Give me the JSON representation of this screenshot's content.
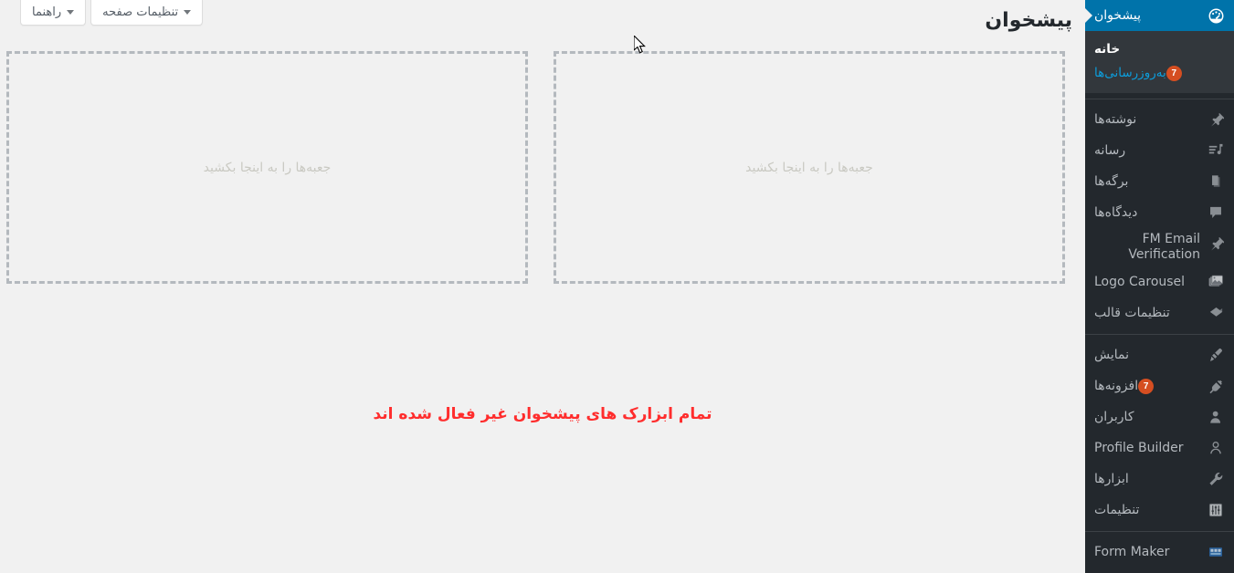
{
  "page": {
    "title": "پیشخوان",
    "widgets_disabled_message": "تمام ابزارک های پیشخوان غیر فعال شده اند"
  },
  "screen_meta": {
    "screen_options_label": "تنظیمات صفحه",
    "help_label": "راهنما"
  },
  "dashboard": {
    "drop_placeholder_right": "جعبه‌ها را به اینجا بکشید",
    "drop_placeholder_left": "جعبه‌ها را به اینجا بکشید"
  },
  "sidebar": {
    "active_item": "پیشخوان",
    "items": [
      {
        "label": "پیشخوان",
        "icon": "dashboard-icon",
        "current": true
      },
      {
        "label": "نوشته‌ها",
        "icon": "pin-icon"
      },
      {
        "label": "رسانه",
        "icon": "media-icon"
      },
      {
        "label": "برگه‌ها",
        "icon": "pages-icon"
      },
      {
        "label": "دیدگاه‌ها",
        "icon": "comments-icon"
      },
      {
        "label": "FM Email Verification",
        "icon": "pin-icon",
        "latin": true
      },
      {
        "label": "Logo Carousel",
        "icon": "gallery-icon",
        "latin": true
      },
      {
        "label": "تنظیمات قالب",
        "icon": "diamond-icon"
      },
      {
        "label": "نمایش",
        "icon": "paintbrush-icon"
      },
      {
        "label": "افزونه‌ها",
        "icon": "plug-icon",
        "badge": "7"
      },
      {
        "label": "کاربران",
        "icon": "users-icon"
      },
      {
        "label": "Profile Builder",
        "icon": "person-outline-icon",
        "latin": true
      },
      {
        "label": "ابزارها",
        "icon": "wrench-icon"
      },
      {
        "label": "تنظیمات",
        "icon": "sliders-icon"
      },
      {
        "label": "Form Maker",
        "icon": "form-icon",
        "latin": true
      }
    ],
    "submenu": {
      "home_label": "خانه",
      "updates_label": "به‌روزرسانی‌ها",
      "updates_badge": "7"
    }
  },
  "colors": {
    "menu_bg": "#23282d",
    "submenu_bg": "#32373c",
    "accent_blue": "#0073aa",
    "badge_orange": "#d54e21",
    "content_bg": "#f1f1f1",
    "warning_red": "#ff2d2d",
    "link_blue": "#0d9ddb"
  }
}
